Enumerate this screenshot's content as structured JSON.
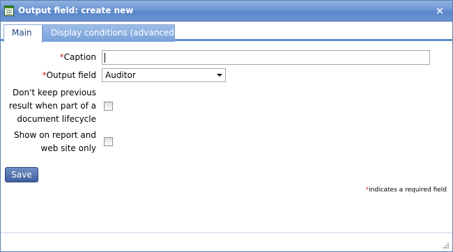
{
  "window": {
    "title": "Output field: create new",
    "close_label": "✕"
  },
  "tabs": [
    {
      "label": "Main",
      "active": true
    },
    {
      "label": "Display conditions (advanced)",
      "active": false
    }
  ],
  "form": {
    "required_marker": "*",
    "caption": {
      "label": "Caption",
      "value": ""
    },
    "output_field": {
      "label": "Output field",
      "value": "Auditor"
    },
    "dont_keep": {
      "label_lines": [
        "Don't keep previous",
        "result when part of a",
        "document lifecycle"
      ],
      "checked": false
    },
    "show_on_report": {
      "label_lines": [
        "Show on report and",
        "web site only"
      ],
      "checked": false
    }
  },
  "actions": {
    "save_label": "Save"
  },
  "note": {
    "marker": "*",
    "text": "indicates a required field"
  },
  "colors": {
    "titlebar": "#6d96d2",
    "required": "#d21f1f",
    "save_button": "#4f6fad"
  }
}
